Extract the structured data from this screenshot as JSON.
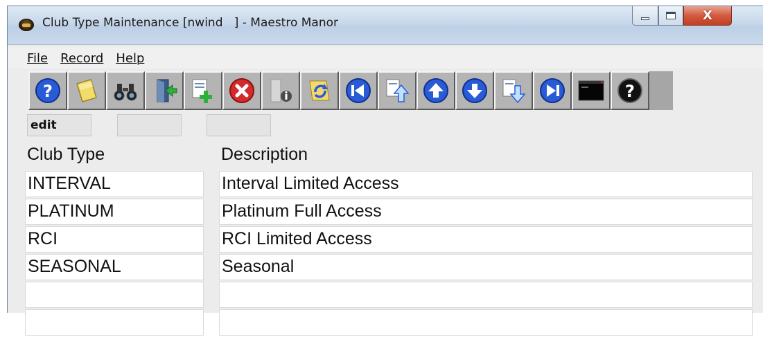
{
  "window": {
    "title": "Club Type Maintenance [nwind   ] - Maestro Manor",
    "close_glyph": "X"
  },
  "menu": {
    "items": [
      {
        "label": "File"
      },
      {
        "label": "Record"
      },
      {
        "label": "Help"
      }
    ]
  },
  "toolbar": {
    "buttons": [
      {
        "icon": "help-icon"
      },
      {
        "icon": "notepad-icon"
      },
      {
        "icon": "binoculars-icon"
      },
      {
        "icon": "exit-door-icon"
      },
      {
        "icon": "add-record-icon"
      },
      {
        "icon": "delete-icon"
      },
      {
        "icon": "info-icon"
      },
      {
        "icon": "refresh-icon"
      },
      {
        "icon": "first-record-icon"
      },
      {
        "icon": "page-up-icon"
      },
      {
        "icon": "previous-record-icon"
      },
      {
        "icon": "next-record-icon"
      },
      {
        "icon": "page-down-icon"
      },
      {
        "icon": "last-record-icon"
      },
      {
        "icon": "console-icon"
      },
      {
        "icon": "question-icon"
      }
    ]
  },
  "status": {
    "mode": "edit",
    "field2": "",
    "field3": ""
  },
  "grid": {
    "columns": [
      "Club Type",
      "Description"
    ],
    "rows": [
      [
        "INTERVAL",
        "Interval Limited Access"
      ],
      [
        "PLATINUM",
        "Platinum Full Access"
      ],
      [
        "RCI",
        "RCI Limited Access"
      ],
      [
        "SEASONAL",
        "Seasonal"
      ],
      [
        "",
        ""
      ],
      [
        "",
        ""
      ]
    ]
  },
  "colors": {
    "toolbar_bg": "#a6a6a6",
    "close_red": "#c13f24",
    "icon_blue": "#2a5bd7"
  }
}
